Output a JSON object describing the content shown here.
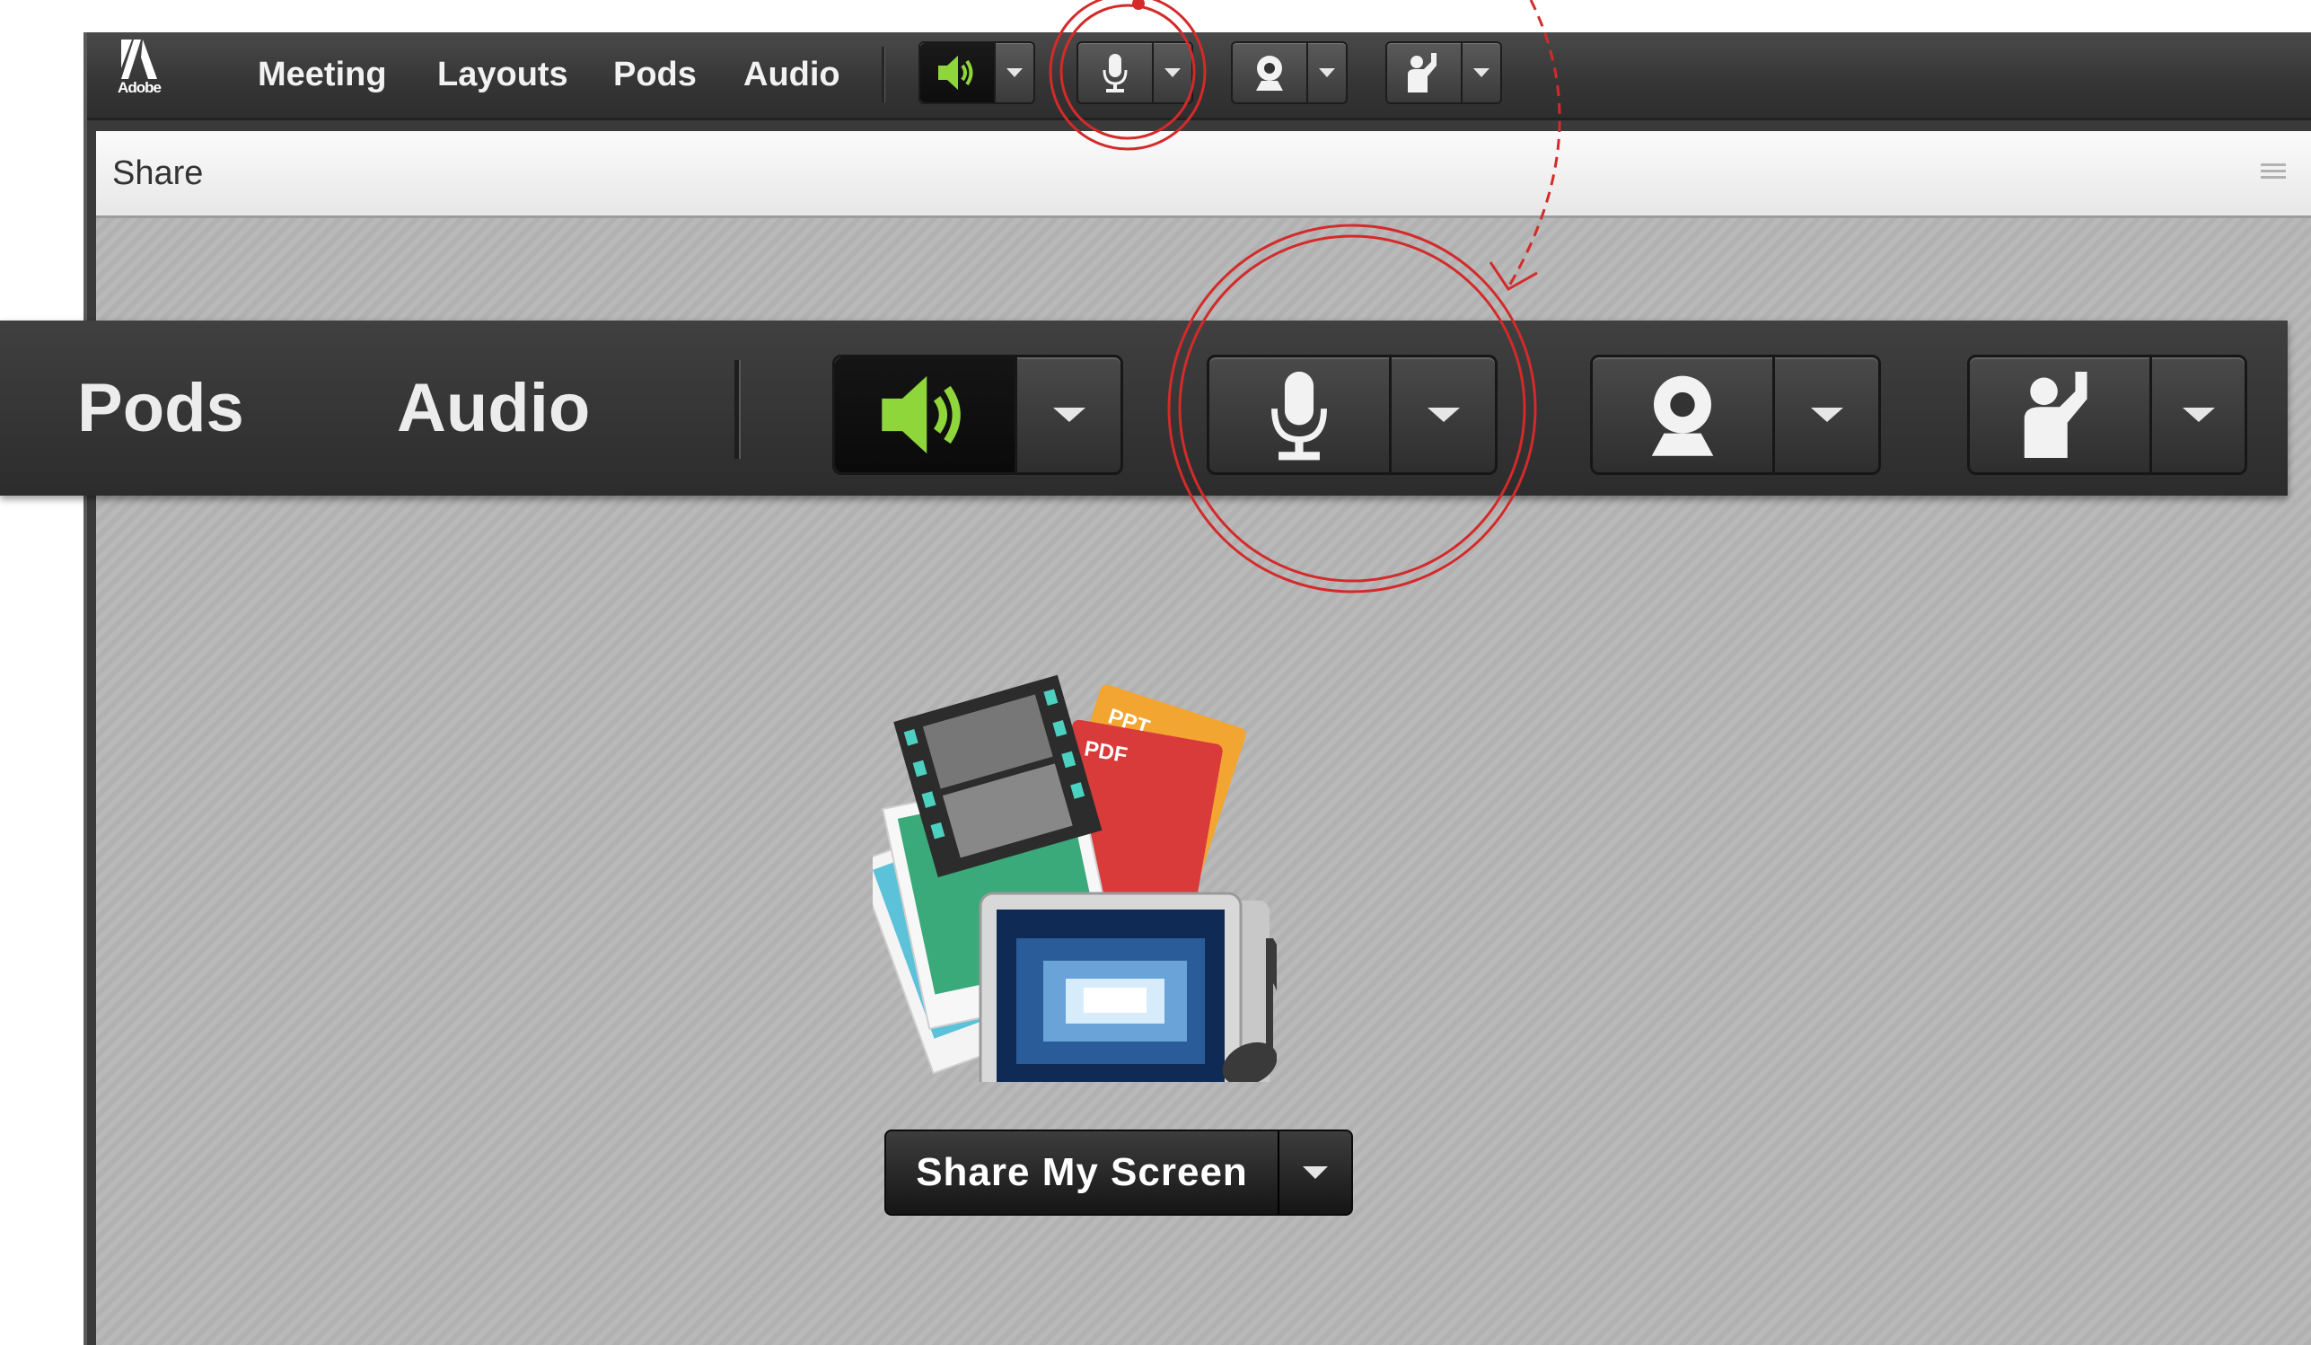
{
  "app": {
    "logo_text": "Adobe",
    "menu": [
      "Meeting",
      "Layouts",
      "Pods",
      "Audio"
    ]
  },
  "toolbar": {
    "buttons": [
      {
        "icon": "speaker-icon",
        "active": true
      },
      {
        "icon": "microphone-icon",
        "active": false
      },
      {
        "icon": "webcam-icon",
        "active": false
      },
      {
        "icon": "raise-hand-icon",
        "active": false
      }
    ]
  },
  "pod": {
    "title": "Share",
    "share_button_label": "Share My Screen",
    "illustration_labels": [
      "PPT",
      "PDF"
    ]
  },
  "zoom": {
    "menu": [
      "Pods",
      "Audio"
    ]
  },
  "colors": {
    "speaker_green": "#8ed63a",
    "annotation_red": "#d42a2a",
    "toolbar_dark": "#3a3a3a"
  }
}
